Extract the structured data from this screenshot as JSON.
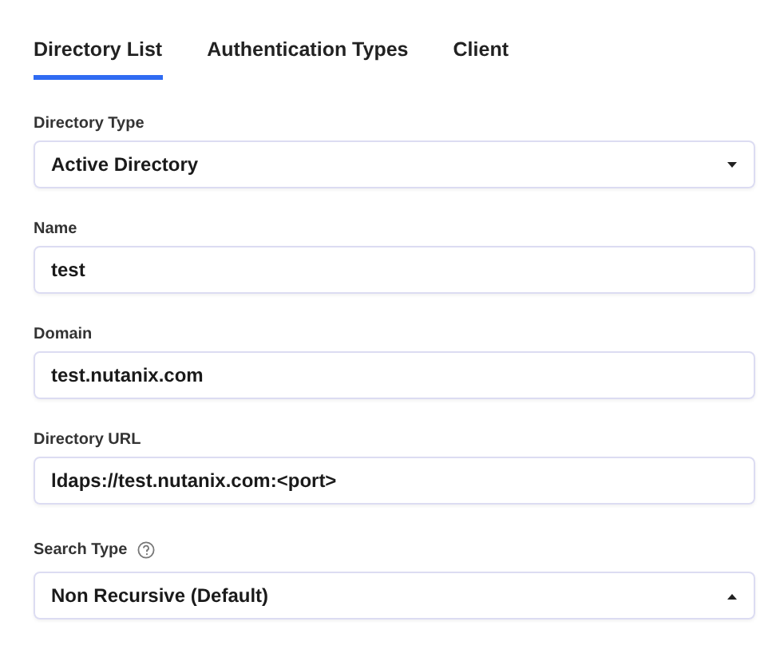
{
  "tabs": [
    {
      "label": "Directory List",
      "selected": true
    },
    {
      "label": "Authentication Types",
      "selected": false
    },
    {
      "label": "Client",
      "selected": false
    }
  ],
  "fields": [
    {
      "label": "Directory Type",
      "kind": "select",
      "value": "Active Directory",
      "expanded": false,
      "help": false
    },
    {
      "label": "Name",
      "kind": "text",
      "value": "test",
      "help": false
    },
    {
      "label": "Domain",
      "kind": "text",
      "value": "test.nutanix.com",
      "help": false
    },
    {
      "label": "Directory URL",
      "kind": "text",
      "value": "ldaps://test.nutanix.com:<port>",
      "help": false
    },
    {
      "label": "Search Type",
      "kind": "select",
      "value": "Non Recursive (Default)",
      "expanded": true,
      "help": true
    }
  ]
}
